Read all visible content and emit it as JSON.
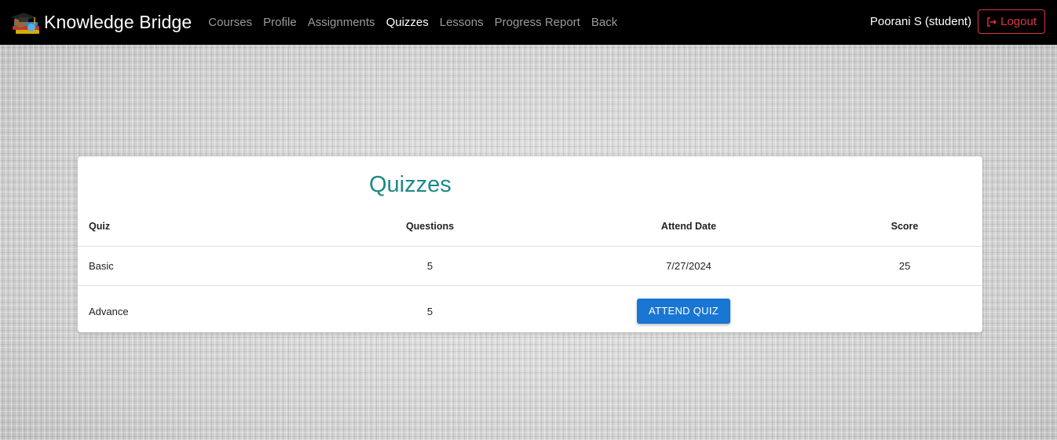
{
  "navbar": {
    "brand_text": "Knowledge Bridge",
    "links": [
      {
        "label": "Courses",
        "active": false
      },
      {
        "label": "Profile",
        "active": false
      },
      {
        "label": "Assignments",
        "active": false
      },
      {
        "label": "Quizzes",
        "active": true
      },
      {
        "label": "Lessons",
        "active": false
      },
      {
        "label": "Progress Report",
        "active": false
      },
      {
        "label": "Back",
        "active": false
      }
    ],
    "user_label": "Poorani S (student)",
    "logout_label": "Logout"
  },
  "colors": {
    "navbar_bg": "#000000",
    "title": "#1b8a86",
    "logout": "#dc3545",
    "primary_button": "#1976d2"
  },
  "quizzes": {
    "title": "Quizzes",
    "headers": {
      "quiz": "Quiz",
      "questions": "Questions",
      "attend_date": "Attend Date",
      "score": "Score"
    },
    "rows": [
      {
        "quiz": "Basic",
        "questions": "5",
        "attend_date": "7/27/2024",
        "score": "25"
      },
      {
        "quiz": "Advance",
        "questions": "5",
        "action_label": "ATTEND QUIZ"
      }
    ]
  }
}
